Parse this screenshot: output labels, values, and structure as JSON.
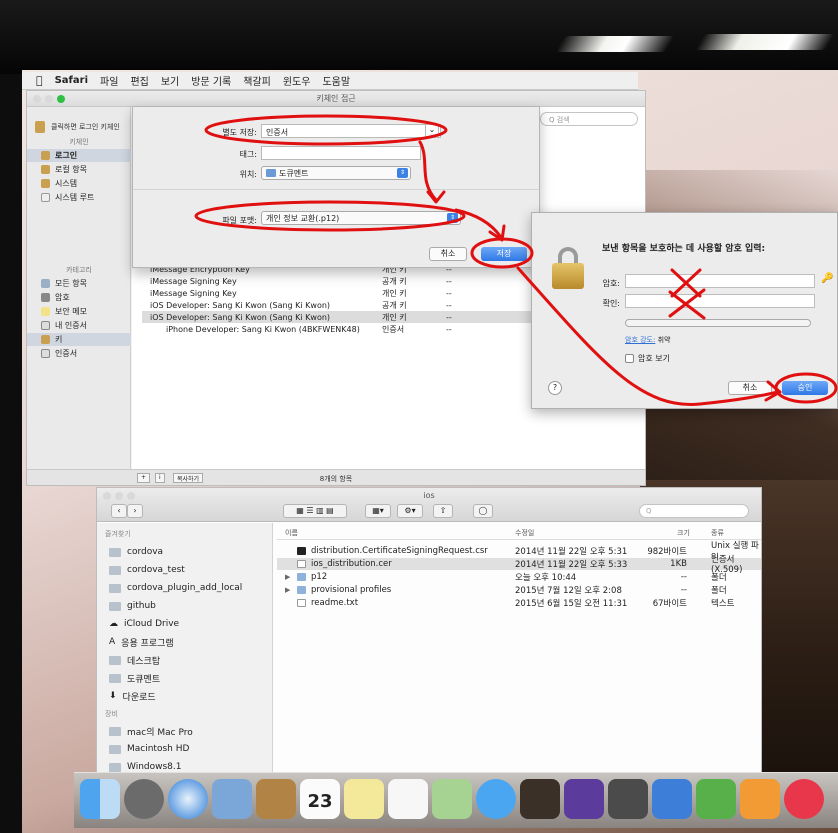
{
  "menubar": {
    "app": "Safari",
    "items": [
      "파일",
      "편집",
      "보기",
      "방문 기록",
      "책갈피",
      "윈도우",
      "도움말"
    ]
  },
  "keychain": {
    "title": "키체인 접근",
    "lock_text": "클릭하면 로그인 키체인",
    "sidebar_keychains_header": "키체인",
    "keychains": [
      "로그인",
      "로컬 항목",
      "시스템",
      "시스템 루트"
    ],
    "categories_header": "카테고리",
    "categories": [
      "모든 항목",
      "암호",
      "보안 메모",
      "내 인증서",
      "키",
      "인증서"
    ],
    "rows": [
      {
        "name": "iMessage Encryption Key",
        "kind": "개인 키",
        "date": "--"
      },
      {
        "name": "iMessage Signing Key",
        "kind": "공개 키",
        "date": "--"
      },
      {
        "name": "iMessage Signing Key",
        "kind": "개인 키",
        "date": "--"
      },
      {
        "name": "iOS Developer: Sang Ki Kwon (Sang Ki Kwon)",
        "kind": "공개 키",
        "date": "--"
      },
      {
        "name": "iOS Developer: Sang Ki Kwon (Sang Ki Kwon)",
        "kind": "개인 키",
        "date": "--"
      },
      {
        "name": "iPhone Developer: Sang Ki Kwon (4BKFWENK48)",
        "kind": "인증서",
        "date": "--"
      }
    ],
    "status_count": "8개의 항목",
    "copy_button": "복사하기",
    "search_placeholder": "Q 검색"
  },
  "save_sheet": {
    "save_as_label": "별도 저장:",
    "save_as_value": "인증서",
    "tags_label": "태그:",
    "where_label": "위치:",
    "where_value": "도큐멘트",
    "format_label": "파일 포맷:",
    "format_value": "개인 정보 교환(.p12)",
    "cancel": "취소",
    "save": "저장"
  },
  "password_dialog": {
    "title": "보낸 항목을 보호하는 데 사용할 암호 입력:",
    "password_label": "암호:",
    "verify_label": "확인:",
    "strength_label": "암호 강도:",
    "strength_value": "취약",
    "show_password": "암호 보기",
    "help": "?",
    "cancel": "취소",
    "ok": "승인"
  },
  "finder": {
    "title": "ios",
    "search_placeholder": "Q",
    "favorites_header": "즐겨찾기",
    "favorites": [
      "cordova",
      "cordova_test",
      "cordova_plugin_add_local",
      "github",
      "iCloud Drive",
      "응용 프로그램",
      "데스크탑",
      "도큐멘트",
      "다운로드"
    ],
    "devices_header": "장비",
    "devices": [
      "mac의 Mac Pro",
      "Macintosh HD",
      "Windows8.1"
    ],
    "columns": {
      "name": "이름",
      "date": "수정일",
      "size": "크기",
      "kind": "종류"
    },
    "files": [
      {
        "name": "distribution.CertificateSigningRequest.csr",
        "date": "2014년 11월 22일 오후 5:31",
        "size": "982바이트",
        "kind": "Unix 실행 파일",
        "folder": false
      },
      {
        "name": "ios_distribution.cer",
        "date": "2014년 11월 22일 오후 5:33",
        "size": "1KB",
        "kind": "인증서(X.509)",
        "folder": false
      },
      {
        "name": "p12",
        "date": "오늘 오후 10:44",
        "size": "--",
        "kind": "폴더",
        "folder": true
      },
      {
        "name": "provisional profiles",
        "date": "2015년 7월 12일 오후 2:08",
        "size": "--",
        "kind": "폴더",
        "folder": true
      },
      {
        "name": "readme.txt",
        "date": "2015년 6월 15일 오전 11:31",
        "size": "67바이트",
        "kind": "텍스트",
        "folder": false
      }
    ]
  },
  "dock": {
    "calendar_day": "23",
    "icons": [
      "finder-icon",
      "launchpad-icon",
      "safari-icon",
      "mail-icon",
      "contacts-icon",
      "calendar-icon",
      "notes-icon",
      "reminders-icon",
      "maps-icon",
      "messages-icon",
      "garageband-icon",
      "imovie-icon",
      "iphoto-icon",
      "keynote-icon",
      "numbers-icon",
      "pages-icon",
      "itunes-icon"
    ]
  },
  "colors": {
    "accent": "#2f78e6",
    "annotation": "#e01010"
  }
}
